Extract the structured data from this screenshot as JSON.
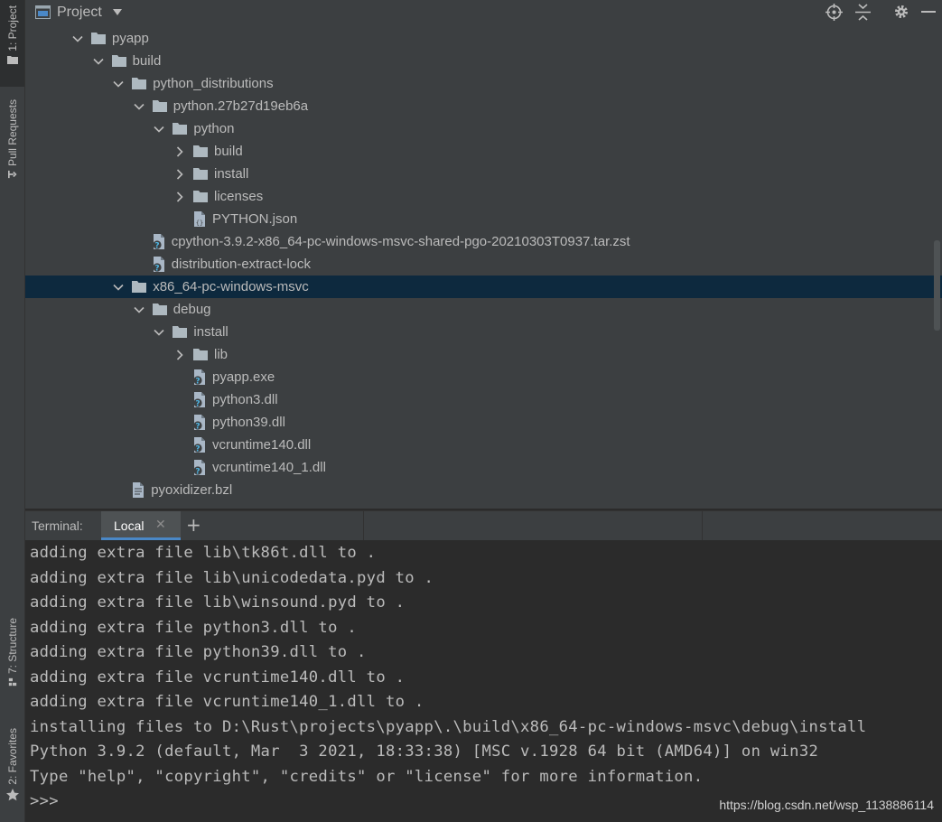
{
  "tool_strip": {
    "project": "1: Project",
    "pull_requests": "Pull Requests",
    "structure": "7: Structure",
    "favorites": "2: Favorites"
  },
  "project_panel": {
    "title": "Project",
    "tree": [
      {
        "label": "pyapp",
        "kind": "folder",
        "depth": 0,
        "state": "expanded"
      },
      {
        "label": "build",
        "kind": "folder",
        "depth": 1,
        "state": "expanded"
      },
      {
        "label": "python_distributions",
        "kind": "folder",
        "depth": 2,
        "state": "expanded"
      },
      {
        "label": "python.27b27d19eb6a",
        "kind": "folder",
        "depth": 3,
        "state": "expanded"
      },
      {
        "label": "python",
        "kind": "folder",
        "depth": 4,
        "state": "expanded"
      },
      {
        "label": "build",
        "kind": "folder",
        "depth": 5,
        "state": "collapsed"
      },
      {
        "label": "install",
        "kind": "folder",
        "depth": 5,
        "state": "collapsed"
      },
      {
        "label": "licenses",
        "kind": "folder",
        "depth": 5,
        "state": "collapsed"
      },
      {
        "label": "PYTHON.json",
        "kind": "json-file",
        "depth": 5,
        "state": "none"
      },
      {
        "label": "cpython-3.9.2-x86_64-pc-windows-msvc-shared-pgo-20210303T0937.tar.zst",
        "kind": "unknown-file",
        "depth": 3,
        "state": "none"
      },
      {
        "label": "distribution-extract-lock",
        "kind": "unknown-file",
        "depth": 3,
        "state": "none"
      },
      {
        "label": "x86_64-pc-windows-msvc",
        "kind": "folder",
        "depth": 2,
        "state": "expanded",
        "selected": true
      },
      {
        "label": "debug",
        "kind": "folder",
        "depth": 3,
        "state": "expanded"
      },
      {
        "label": "install",
        "kind": "folder",
        "depth": 4,
        "state": "expanded"
      },
      {
        "label": "lib",
        "kind": "folder",
        "depth": 5,
        "state": "collapsed"
      },
      {
        "label": "pyapp.exe",
        "kind": "unknown-file",
        "depth": 5,
        "state": "none"
      },
      {
        "label": "python3.dll",
        "kind": "unknown-file",
        "depth": 5,
        "state": "none"
      },
      {
        "label": "python39.dll",
        "kind": "unknown-file",
        "depth": 5,
        "state": "none"
      },
      {
        "label": "vcruntime140.dll",
        "kind": "unknown-file",
        "depth": 5,
        "state": "none"
      },
      {
        "label": "vcruntime140_1.dll",
        "kind": "unknown-file",
        "depth": 5,
        "state": "none"
      },
      {
        "label": "pyoxidizer.bzl",
        "kind": "text-file",
        "depth": 2,
        "state": "none"
      }
    ],
    "header_icons": [
      "locate-icon",
      "collapse-all-icon",
      "gear-icon",
      "minimize-icon"
    ]
  },
  "terminal": {
    "label": "Terminal:",
    "tab_name": "Local",
    "new_tab": "+",
    "lines": [
      "adding extra file lib\\tk86t.dll to .",
      "adding extra file lib\\unicodedata.pyd to .",
      "adding extra file lib\\winsound.pyd to .",
      "adding extra file python3.dll to .",
      "adding extra file python39.dll to .",
      "adding extra file vcruntime140.dll to .",
      "adding extra file vcruntime140_1.dll to .",
      "installing files to D:\\Rust\\projects\\pyapp\\.\\build\\x86_64-pc-windows-msvc\\debug\\install",
      "Python 3.9.2 (default, Mar  3 2021, 18:33:38) [MSC v.1928 64 bit (AMD64)] on win32",
      "Type \"help\", \"copyright\", \"credits\" or \"license\" for more information.",
      ">>>"
    ]
  },
  "watermark": "https://blog.csdn.net/wsp_1138886114",
  "colors": {
    "panel_bg": "#3c3f41",
    "editor_bg": "#2b2b2b",
    "selection": "#0d293e",
    "folder": "#aeb9c0",
    "accent": "#4a88c7"
  }
}
